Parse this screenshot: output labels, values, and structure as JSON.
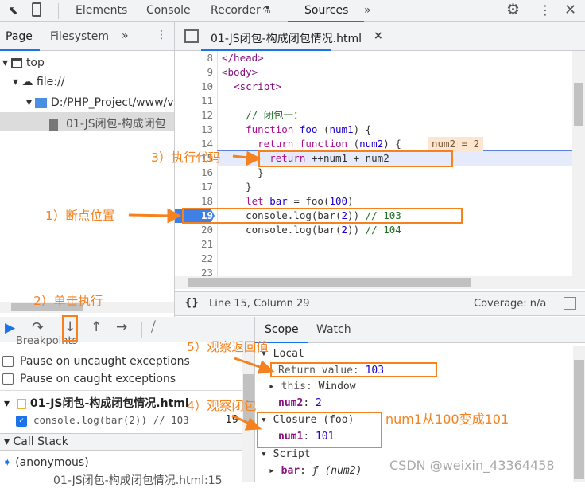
{
  "toolbar": {
    "tabs": [
      "Elements",
      "Console",
      "Recorder",
      "Sources"
    ],
    "active": "Sources",
    "more": "»"
  },
  "navigator": {
    "tabs": [
      "Page",
      "Filesystem"
    ],
    "more": "»",
    "tree": [
      "top",
      "file://",
      "D:/PHP_Project/www/v",
      "01-JS闭包-构成闭包"
    ]
  },
  "editor": {
    "file_tab": "01-JS闭包-构成闭包情况.html",
    "close": "×",
    "lines": [
      {
        "n": "8",
        "html": "<span class='tag'>&lt;/head&gt;</span>"
      },
      {
        "n": "9",
        "html": "<span class='tag'>&lt;body&gt;</span>"
      },
      {
        "n": "10",
        "html": "  <span class='tag'>&lt;script&gt;</span>"
      },
      {
        "n": "11",
        "html": ""
      },
      {
        "n": "12",
        "html": "    <span class='cm'>// 闭包一：</span>"
      },
      {
        "n": "13",
        "html": "    <span class='kw'>function</span> <span class='fn'>foo</span> (<span class='fn'>num1</span>) {"
      },
      {
        "n": "14",
        "html": "      <span class='kw'>return</span> <span class='kw'>function</span> (<span class='fn'>num2</span>) {"
      },
      {
        "n": "15",
        "html": "        <span class='kw'>return</span> ++num1 + num2"
      },
      {
        "n": "16",
        "html": "      }"
      },
      {
        "n": "17",
        "html": "    }"
      },
      {
        "n": "18",
        "html": "    <span class='kw'>let</span> <span class='fn'>bar</span> = foo(<span class='num'>100</span>)"
      },
      {
        "n": "19",
        "html": "    console.log(bar(<span class='num'>2</span>)) <span class='cm'>// 103</span>"
      },
      {
        "n": "20",
        "html": "    console.log(bar(<span class='num'>2</span>)) <span class='cm'>// 104</span>"
      },
      {
        "n": "21",
        "html": ""
      },
      {
        "n": "22",
        "html": ""
      },
      {
        "n": "23",
        "html": ""
      }
    ],
    "inline_value": "num2 = 2"
  },
  "status": {
    "braces": "{}",
    "position": "Line 15, Column 29",
    "coverage": "Coverage: n/a"
  },
  "breakpoints": {
    "header": "Breakpoints",
    "uncaught": "Pause on uncaught exceptions",
    "caught": "Pause on caught exceptions",
    "file": "01-JS闭包-构成闭包情况.html",
    "bp_code": "console.log(bar(2)) // 103",
    "bp_line": "19"
  },
  "callstack": {
    "header": "Call Stack",
    "frame": "(anonymous)",
    "location": "01-JS闭包-构成闭包情况.html:15"
  },
  "scope": {
    "tabs": [
      "Scope",
      "Watch"
    ],
    "local": "Local",
    "return_label": "Return value: ",
    "return_value": "103",
    "this_label": "this: ",
    "this_value": "Window",
    "num2_label": "num2",
    "num2_value": "2",
    "closure": "Closure (foo)",
    "num1_label": "num1",
    "num1_value": "101",
    "script": "Script",
    "bar_label": "bar",
    "bar_value": "ƒ (num2)"
  },
  "annotations": {
    "a1": "1）断点位置",
    "a2": "2）单击执行",
    "a3": "3）执行代码",
    "a4": "4）观察闭包",
    "a5": "5）观察返回值",
    "note": "num1从100变成101"
  },
  "watermark": "CSDN @weixin_43364458",
  "colors": {
    "accent": "#1a73e8",
    "annotation": "#f5821f"
  }
}
